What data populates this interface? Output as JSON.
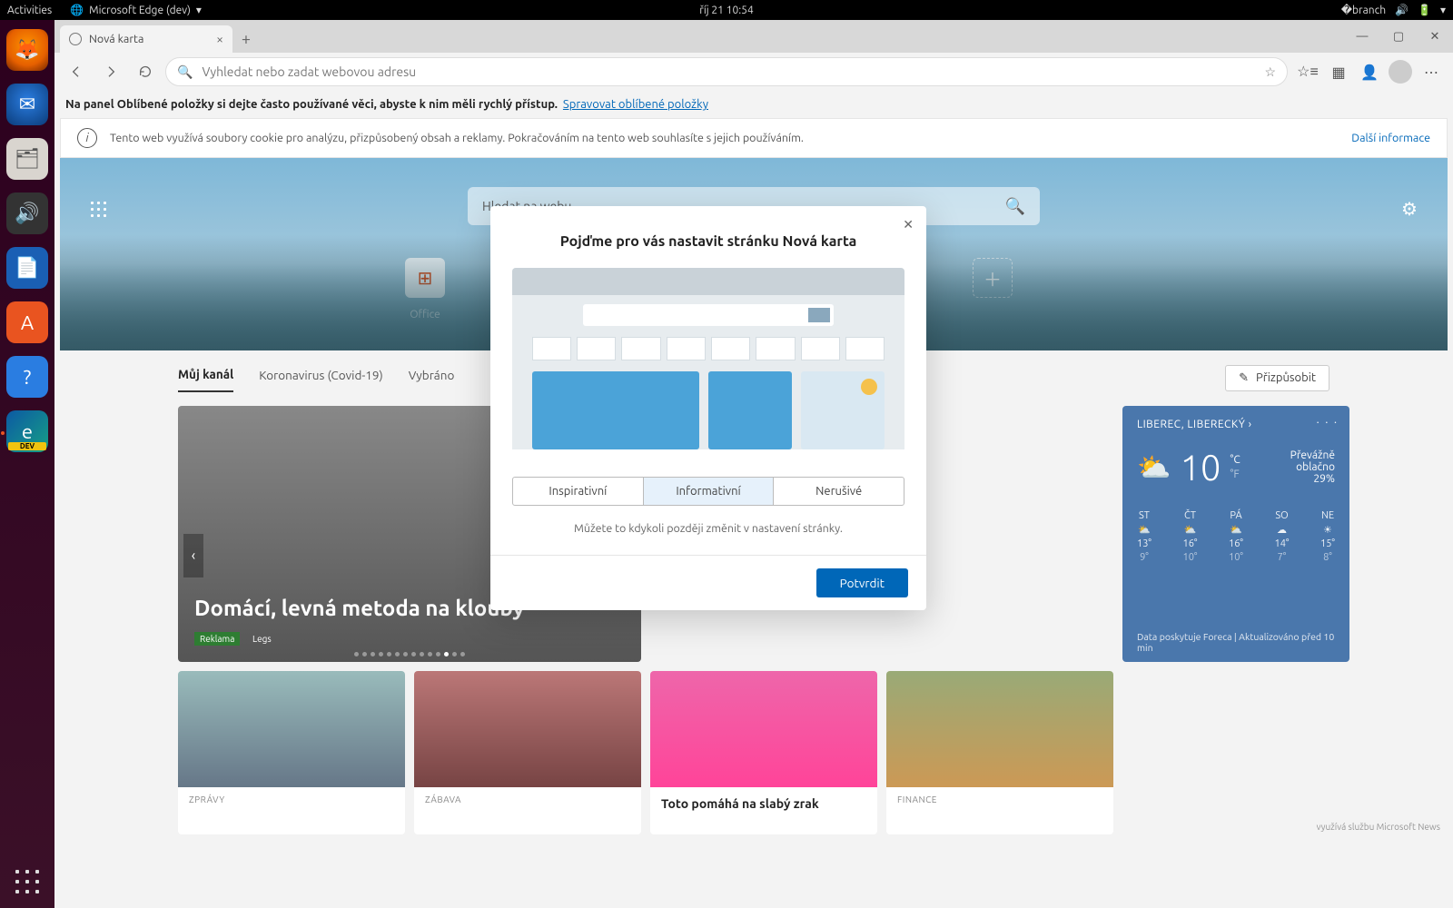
{
  "gnome": {
    "activities": "Activities",
    "app": "Microsoft Edge (dev)",
    "clock": "říj 21  10:54"
  },
  "dock": {
    "edge_dev": "DEV"
  },
  "tab": {
    "title": "Nová karta"
  },
  "toolbar": {
    "placeholder": "Vyhledat nebo zadat webovou adresu"
  },
  "favbar": {
    "text": "Na panel Oblíbené položky si dejte často používané věci, abyste k nim měli rychlý přístup.",
    "link": "Spravovat oblíbené položky"
  },
  "cookie": {
    "text": "Tento web využívá soubory cookie pro analýzu, přizpůsobený obsah a reklamy. Pokračováním na tento web souhlasíte s jejich používáním.",
    "more": "Další informace"
  },
  "hero": {
    "search_placeholder": "Hledat na webu",
    "tiles": {
      "office": "Office"
    }
  },
  "feed": {
    "tabs": [
      "Můj kanál",
      "Koronavirus (Covid-19)",
      "Vybráno"
    ],
    "customize": "Přizpůsobit"
  },
  "hero_card": {
    "title": "Domácí, levná metoda na klouby",
    "tag1": "Reklama",
    "tag2": "Legs"
  },
  "weather": {
    "location": "LIBEREC, LIBERECKÝ",
    "temp": "10",
    "unit_c": "°C",
    "unit_f": "°F",
    "desc": "Převážně oblačno",
    "humidity": "29%",
    "days": [
      "ST",
      "ČT",
      "PÁ",
      "SO",
      "NE"
    ],
    "his": [
      "13°",
      "16°",
      "16°",
      "14°",
      "15°"
    ],
    "los": [
      "9°",
      "10°",
      "10°",
      "7°",
      "8°"
    ],
    "footer": "Data poskytuje Foreca | Aktualizováno před 10 min"
  },
  "news": [
    {
      "cat": "ZPRÁVY",
      "title": ""
    },
    {
      "cat": "ZÁBAVA",
      "title": ""
    },
    {
      "cat": "",
      "title": "Toto pomáhá na slabý zrak"
    },
    {
      "cat": "FINANCE",
      "title": ""
    }
  ],
  "footer_brand": {
    "l1": "využívá službu Microsoft News"
  },
  "modal": {
    "title": "Pojďme pro vás nastavit stránku Nová karta",
    "options": [
      "Inspirativní",
      "Informativní",
      "Nerušivé"
    ],
    "note": "Můžete to kdykoli později změnit v nastavení stránky.",
    "confirm": "Potvrdit"
  }
}
